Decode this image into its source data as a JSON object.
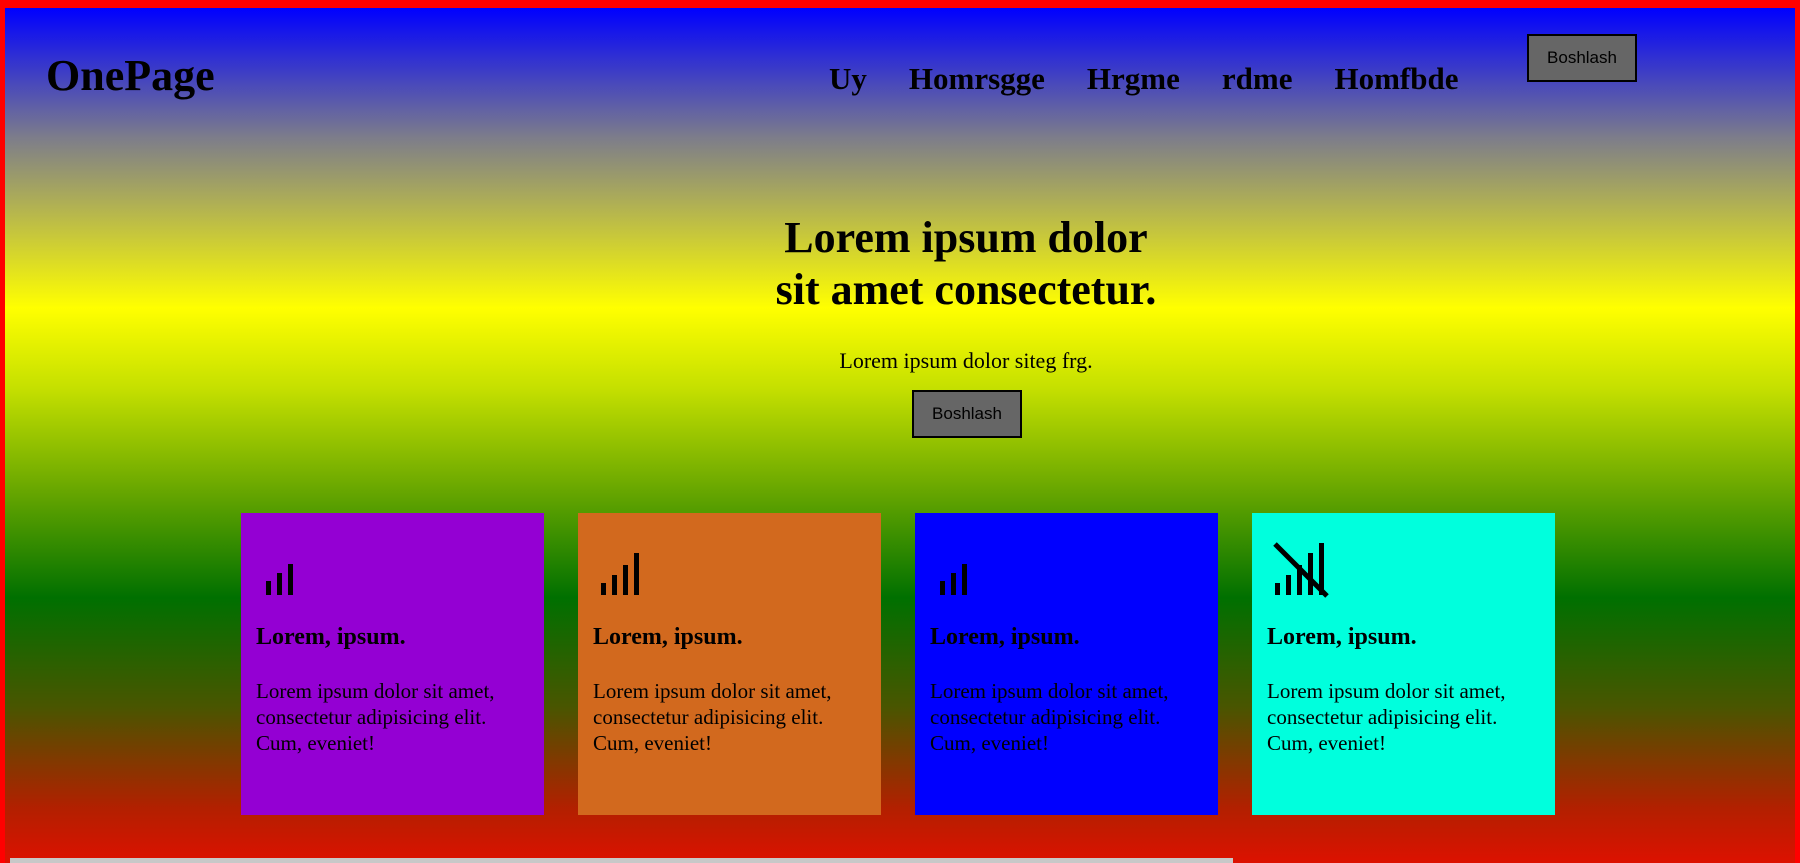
{
  "header": {
    "logo": "OnePage",
    "nav": [
      "Uy",
      "Homrsgge",
      "Hrgme",
      "rdme",
      "Homfbde"
    ],
    "button_label": "Boshlash"
  },
  "hero": {
    "title_line1": "Lorem ipsum dolor",
    "title_line2": "sit amet consectetur.",
    "subtitle": "Lorem ipsum dolor siteg frg.",
    "button_label": "Boshlash"
  },
  "cards": [
    {
      "icon": "signal-low-icon",
      "color": "#9400d3",
      "title": "Lorem, ipsum.",
      "text": "Lorem ipsum dolor sit amet, consectetur adipisicing elit. Cum, eveniet!"
    },
    {
      "icon": "signal-full-icon",
      "color": "#d2691e",
      "title": "Lorem, ipsum.",
      "text": "Lorem ipsum dolor sit amet, consectetur adipisicing elit. Cum, eveniet!"
    },
    {
      "icon": "signal-low-icon",
      "color": "#0000ff",
      "title": "Lorem, ipsum.",
      "text": "Lorem ipsum dolor sit amet, consectetur adipisicing elit. Cum, eveniet!"
    },
    {
      "icon": "signal-off-icon",
      "color": "#00ffdd",
      "title": "Lorem, ipsum.",
      "text": "Lorem ipsum dolor sit amet, consectetur adipisicing elit. Cum, eveniet!"
    }
  ],
  "colors": {
    "frame": "#ff0000",
    "button_bg": "#666666"
  }
}
